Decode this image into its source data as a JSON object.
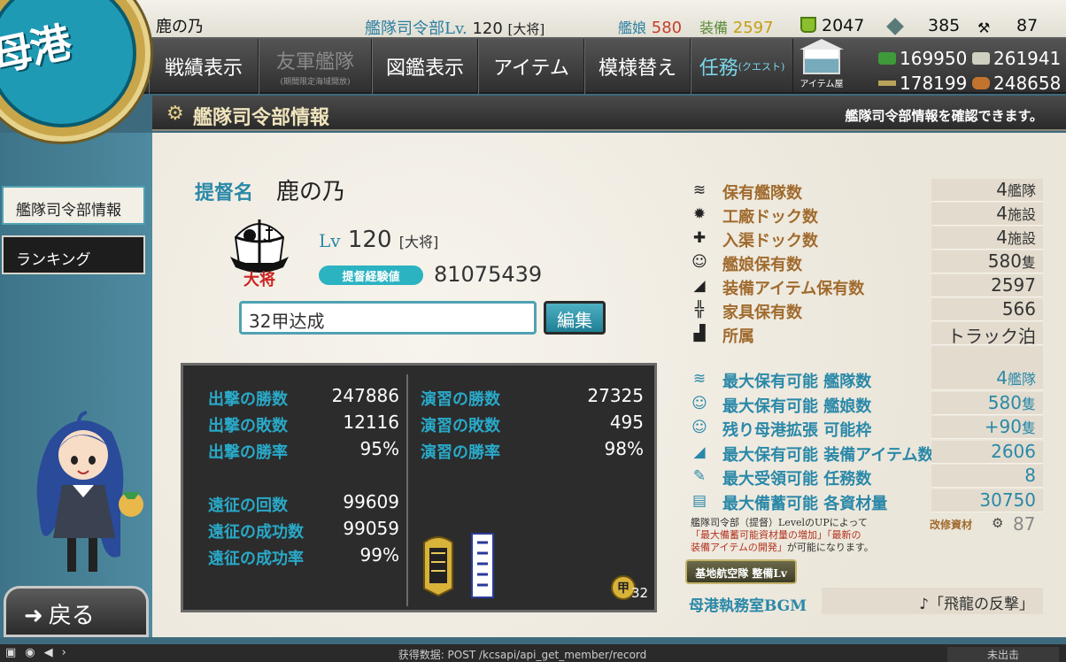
{
  "logo": {
    "text": "母港"
  },
  "top": {
    "player_name": "鹿の乃",
    "hq_label": "艦隊司令部Lv.",
    "hq_level": "120",
    "hq_rank": "[大将]",
    "ships_label": "艦娘",
    "ships_value": "580",
    "equip_label": "装備",
    "equip_value": "2597",
    "bucket": "2047",
    "devmat": "385",
    "screw": "87"
  },
  "nav": {
    "items": [
      {
        "label": "戦績表示"
      },
      {
        "label": "友軍艦隊",
        "sub": "(期間限定海域開放)"
      },
      {
        "label": "図鑑表示"
      },
      {
        "label": "アイテム"
      },
      {
        "label": "模様替え"
      },
      {
        "label": "任務",
        "small": "(クエスト)"
      }
    ],
    "shop_label": "アイテム屋",
    "fuel": "169950",
    "ammo": "261941",
    "steel": "178199",
    "bauxite": "248658"
  },
  "title": {
    "heading": "艦隊司令部情報",
    "hint": "艦隊司令部情報を確認できます。"
  },
  "sidebar": {
    "items": [
      {
        "label": "艦隊司令部情報"
      },
      {
        "label": "ランキング"
      }
    ],
    "back_label": "戻る"
  },
  "profile": {
    "admiral_label": "提督名",
    "admiral_name": "鹿の乃",
    "emblem_text": "大将",
    "lv_label": "Lv",
    "level": "120",
    "rank": "[大将]",
    "exp_label": "提督経験値",
    "exp_value": "81075439",
    "comment": "32甲达成",
    "edit_label": "編集"
  },
  "record": {
    "left": [
      {
        "label": "出撃の勝数",
        "value": "247886"
      },
      {
        "label": "出撃の敗数",
        "value": "12116"
      },
      {
        "label": "出撃の勝率",
        "value": "95%"
      },
      {
        "label": "遠征の回数",
        "value": "99609"
      },
      {
        "label": "遠征の成功数",
        "value": "99059"
      },
      {
        "label": "遠征の成功率",
        "value": "99%"
      }
    ],
    "right": [
      {
        "label": "演習の勝数",
        "value": "27325"
      },
      {
        "label": "演習の敗数",
        "value": "495"
      },
      {
        "label": "演習の勝率",
        "value": "98%"
      }
    ],
    "medal_count": "32",
    "medal_text": "甲"
  },
  "stats": [
    {
      "icon": "≋",
      "label": "保有艦隊数",
      "value": "4",
      "unit": "艦隊"
    },
    {
      "icon": "✹",
      "label": "工廠ドック数",
      "value": "4",
      "unit": "施設"
    },
    {
      "icon": "✚",
      "label": "入渠ドック数",
      "value": "4",
      "unit": "施設"
    },
    {
      "icon": "☺",
      "label": "艦娘保有数",
      "value": "580",
      "unit": "隻"
    },
    {
      "icon": "◢",
      "label": "装備アイテム保有数",
      "value": "2597",
      "unit": ""
    },
    {
      "icon": "╬",
      "label": "家具保有数",
      "value": "566",
      "unit": ""
    },
    {
      "icon": "▟",
      "label": "所属",
      "value": "トラック泊地",
      "unit": ""
    }
  ],
  "max_stats": [
    {
      "icon": "≋",
      "label": "最大保有可能 艦隊数",
      "value": "4",
      "unit": "艦隊"
    },
    {
      "icon": "☺",
      "label": "最大保有可能 艦娘数",
      "value": "580",
      "unit": "隻"
    },
    {
      "icon": "☺",
      "label": "残り母港拡張 可能枠",
      "value": "+90",
      "unit": "隻"
    },
    {
      "icon": "◢",
      "label": "最大保有可能 装備アイテム数",
      "value": "2606",
      "unit": ""
    },
    {
      "icon": "✎",
      "label": "最大受領可能 任務数",
      "value": "8",
      "unit": ""
    },
    {
      "icon": "▤",
      "label": "最大備蓄可能 各資材量",
      "value": "30750",
      "unit": ""
    }
  ],
  "note": {
    "line1": "艦隊司令部（提督）LevelのUPによって",
    "line2": "「最大備蓄可能資材量の増加」「最新の",
    "line3": "装備アイテムの開発」",
    "line3b": "が可能になります。",
    "kaishu_label": "改修資材",
    "kaishu_value": "87"
  },
  "base_btn": "基地航空隊 整備Lv",
  "bgm": {
    "label": "母港執務室BGM",
    "value": "♪「飛龍の反撃」"
  },
  "statusbar": {
    "center": "获得数据: POST /kcsapi/api_get_member/record",
    "right": "未出击"
  },
  "colors": {
    "accent": "#2a88a8",
    "label_brown": "#a06b2e",
    "record_blue": "#29a9c8"
  }
}
